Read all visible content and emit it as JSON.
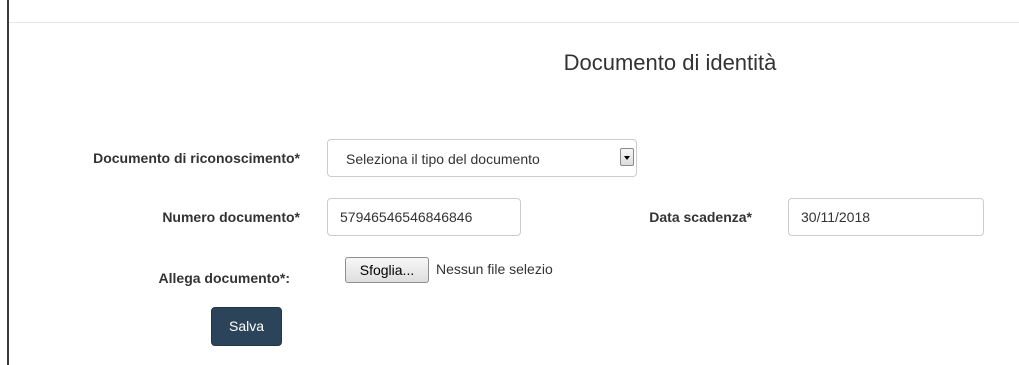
{
  "page": {
    "title": "Documento di identità"
  },
  "form": {
    "document_type": {
      "label": "Documento di riconoscimento*",
      "selected": "Seleziona il tipo del documento"
    },
    "document_number": {
      "label": "Numero documento*",
      "value": "57946546546846846"
    },
    "expiry_date": {
      "label": "Data scadenza*",
      "value": "30/11/2018"
    },
    "attachment": {
      "label": "Allega documento*:",
      "button_label": "Sfoglia...",
      "status": "Nessun file selezio"
    },
    "save_label": "Salva"
  },
  "colors": {
    "save_button_bg": "#2c4459",
    "input_border": "#cccccc",
    "text": "#333333"
  },
  "icons": {
    "select_arrow": "chevron-down-icon"
  }
}
